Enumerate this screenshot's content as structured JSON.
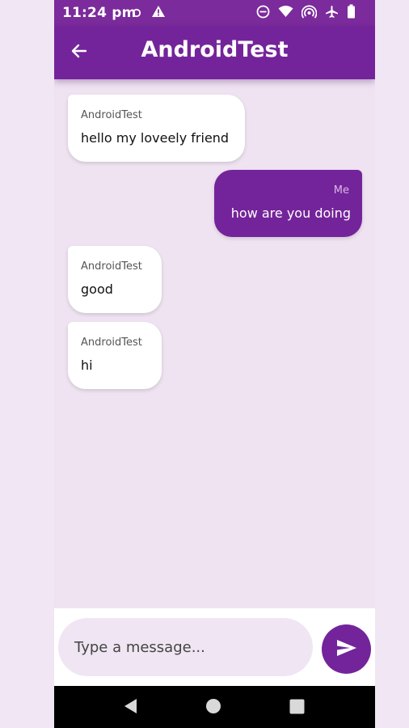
{
  "status_bar": {
    "time": "11:24 pm",
    "icons_left": [
      "circle-outline-icon",
      "alert-triangle-icon"
    ],
    "icons_right": [
      "do-not-disturb-icon",
      "wifi-icon",
      "hotspot-icon",
      "airplane-icon",
      "battery-icon"
    ]
  },
  "app_bar": {
    "title": "AndroidTest",
    "back_icon": "arrow-left-icon"
  },
  "messages": [
    {
      "direction": "incoming",
      "sender": "AndroidTest",
      "text": "hello my loveely friend"
    },
    {
      "direction": "outgoing",
      "sender": "Me",
      "text": "how are you doing"
    },
    {
      "direction": "incoming",
      "sender": "AndroidTest",
      "text": "good"
    },
    {
      "direction": "incoming",
      "sender": "AndroidTest",
      "text": "hi"
    }
  ],
  "composer": {
    "placeholder": "Type a message...",
    "value": "",
    "send_icon": "send-icon"
  },
  "nav_bar": {
    "icons": [
      "back-triangle-icon",
      "home-circle-icon",
      "recents-square-icon"
    ]
  },
  "colors": {
    "primary": "#74249a",
    "status_bar": "#7b2b9b",
    "chat_background": "#efe3f2",
    "incoming_bubble": "#ffffff",
    "outgoing_bubble": "#74249a"
  }
}
